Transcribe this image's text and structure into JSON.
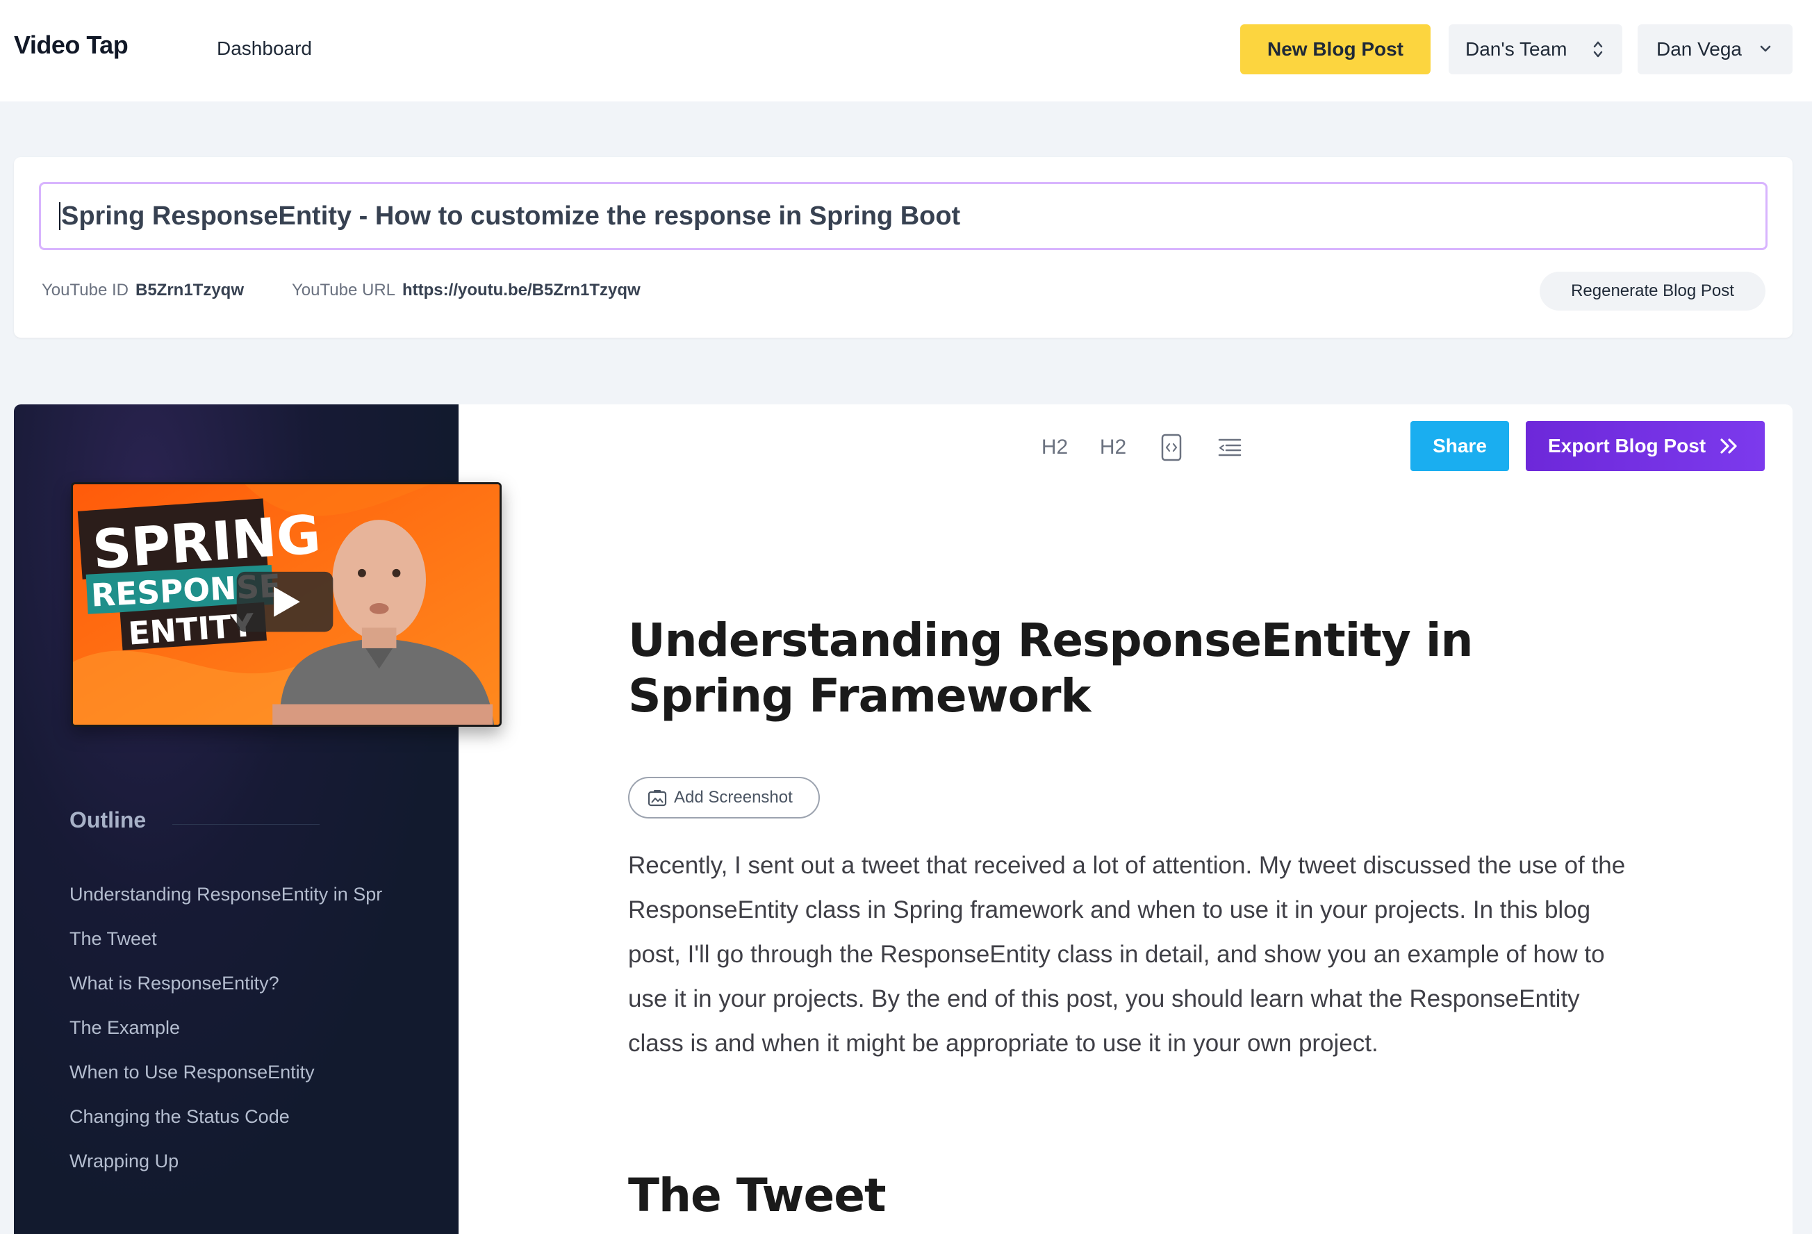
{
  "app": {
    "brand": "Video Tap",
    "nav_dashboard": "Dashboard"
  },
  "header": {
    "new_post_label": "New Blog Post",
    "team_label": "Dan's Team",
    "user_label": "Dan Vega"
  },
  "post": {
    "title_value": "Spring ResponseEntity -  How to customize the response in Spring Boot",
    "youtube_id_label": "YouTube ID",
    "youtube_id": "B5Zrn1Tzyqw",
    "youtube_url_label": "YouTube URL",
    "youtube_url": "https://youtu.be/B5Zrn1Tzyqw",
    "regenerate_label": "Regenerate Blog Post"
  },
  "thumbnail": {
    "line1": "SPRING",
    "line2": "RESPONSE",
    "line3": "ENTITY"
  },
  "sidebar": {
    "outline_heading": "Outline",
    "items": [
      "Understanding ResponseEntity in Spr",
      "The Tweet",
      "What is ResponseEntity?",
      "The Example",
      "When to Use ResponseEntity",
      "Changing the Status Code",
      "Wrapping Up"
    ]
  },
  "toolbar": {
    "h2_label_1": "H2",
    "h2_label_2": "H2",
    "share_label": "Share",
    "export_label": "Export Blog Post"
  },
  "content": {
    "heading1": "Understanding ResponseEntity in Spring Framework",
    "add_screenshot_label": "Add Screenshot",
    "paragraph1": "Recently, I sent out a tweet that received a lot of attention. My tweet discussed the use of the ResponseEntity class in Spring framework and when to use it in your projects. In this blog post, I'll go through the ResponseEntity class in detail, and show you an example of how to use it in your projects. By the end of this post, you should learn what the ResponseEntity class is and when it might be appropriate to use it in your own project.",
    "heading2": "The Tweet"
  },
  "colors": {
    "accent_yellow": "#fcd53f",
    "share_blue": "#1aaef0",
    "export_purple": "#6d28d9",
    "sidebar_bg": "#121a2e",
    "title_border": "#d8b4fe"
  }
}
